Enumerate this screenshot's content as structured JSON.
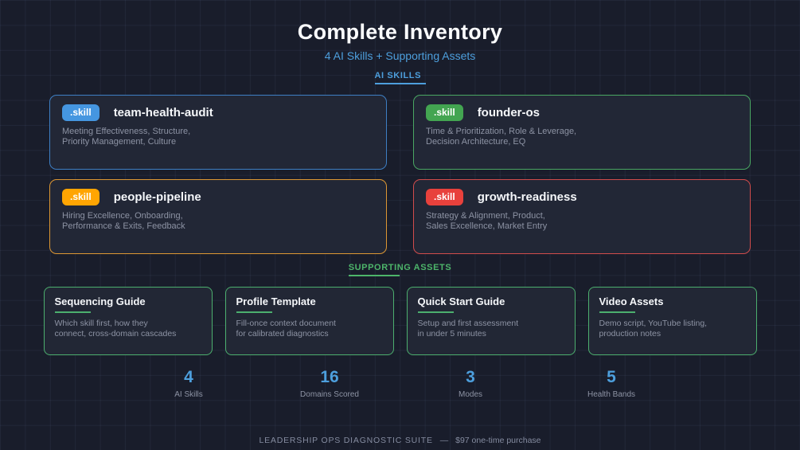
{
  "header": {
    "title": "Complete Inventory",
    "subtitle": "4 AI Skills + Supporting Assets"
  },
  "sections": {
    "skills_label": "AI SKILLS",
    "assets_label": "SUPPORTING ASSETS"
  },
  "skills": [
    {
      "badge": ".skill",
      "name": "team-health-audit",
      "description": "Meeting Effectiveness, Structure,\nPriority Management, Culture",
      "badge_color": "#4596e0",
      "border_color": "#3e7fc4"
    },
    {
      "badge": ".skill",
      "name": "founder-os",
      "description": "Time & Prioritization, Role & Leverage,\nDecision Architecture, EQ",
      "badge_color": "#43a551",
      "border_color": "#4aa763"
    },
    {
      "badge": ".skill",
      "name": "people-pipeline",
      "description": "Hiring Excellence, Onboarding,\nPerformance & Exits, Feedback",
      "badge_color": "#ffa502",
      "border_color": "#dd9733"
    },
    {
      "badge": ".skill",
      "name": "growth-readiness",
      "description": "Strategy & Alignment, Product,\nSales Excellence, Market Entry",
      "badge_color": "#e8413c",
      "border_color": "#d14c4c"
    }
  ],
  "assets": [
    {
      "title": "Sequencing Guide",
      "description": "Which skill first, how they\nconnect, cross-domain cascades"
    },
    {
      "title": "Profile Template",
      "description": "Fill-once context document\nfor calibrated diagnostics"
    },
    {
      "title": "Quick Start Guide",
      "description": "Setup and first assessment\nin under 5 minutes"
    },
    {
      "title": "Video Assets",
      "description": "Demo script, YouTube listing,\nproduction notes"
    }
  ],
  "stats": [
    {
      "value": "4",
      "label": "AI Skills"
    },
    {
      "value": "16",
      "label": "Domains Scored"
    },
    {
      "value": "3",
      "label": "Modes"
    },
    {
      "value": "5",
      "label": "Health Bands"
    }
  ],
  "footer": {
    "brand": "LEADERSHIP OPS DIAGNOSTIC SUITE",
    "separator": "—",
    "price": "$97 one-time purchase"
  },
  "colors": {
    "accent_blue": "#4d9fdd",
    "accent_green": "#4db56a",
    "accent_orange": "#ffa502",
    "accent_red": "#e8413c",
    "card_background": "#222736",
    "page_background": "#191d2b"
  }
}
